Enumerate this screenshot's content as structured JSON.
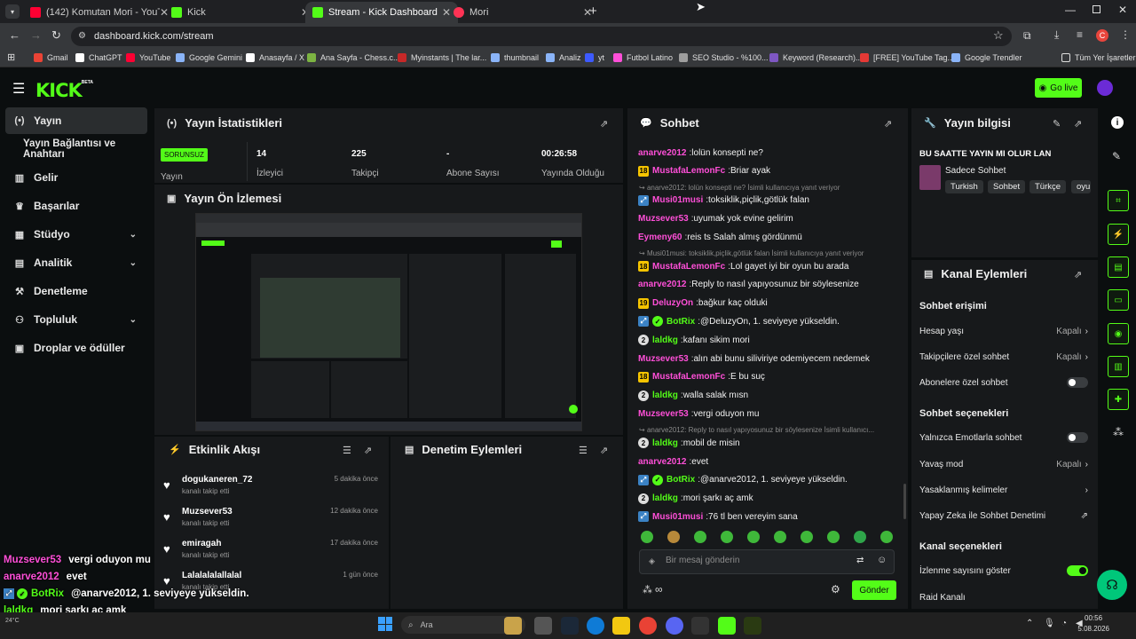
{
  "browser": {
    "tabs": [
      {
        "title": "(142) Komutan Mori - YouTube",
        "color": "#ff0033"
      },
      {
        "title": "Kick",
        "color": "#53fc18"
      },
      {
        "title": "Stream - Kick Dashboard",
        "color": "#53fc18"
      },
      {
        "title": "Mori",
        "color": "#ff3355"
      }
    ],
    "url": "dashboard.kick.com/stream",
    "profile_initial": "C",
    "bookmarks": [
      "Gmail",
      "ChatGPT",
      "YouTube",
      "Google Gemini",
      "Anasayfa / X",
      "Ana Sayfa - Chess.c...",
      "Myinstants | The lar...",
      "thumbnail",
      "Analiz",
      "yt",
      "Futbol Latino",
      "SEO Studio - %100...",
      "Keyword (Research)...",
      "[FREE] YouTube Tag...",
      "Google Trendler"
    ],
    "all_bookmarks": "Tüm Yer İşaretleri"
  },
  "header": {
    "logo": "KICK",
    "beta": "BETA",
    "go_live": "Go live"
  },
  "sidebar": {
    "items": [
      {
        "label": "Yayın",
        "icon": "broadcast-icon"
      },
      {
        "label": "Yayın Bağlantısı ve Anahtarı",
        "icon": ""
      },
      {
        "label": "Gelir",
        "icon": "chart-icon"
      },
      {
        "label": "Başarılar",
        "icon": "trophy-icon"
      },
      {
        "label": "Stüdyo",
        "icon": "studio-icon"
      },
      {
        "label": "Analitik",
        "icon": "analytics-icon"
      },
      {
        "label": "Denetleme",
        "icon": "hammer-icon"
      },
      {
        "label": "Topluluk",
        "icon": "community-icon"
      },
      {
        "label": "Droplar ve ödüller",
        "icon": "gift-icon"
      }
    ]
  },
  "stats": {
    "title": "Yayın İstatistikleri",
    "status_badge": "SORUNSUZ",
    "status_label": "Yayın",
    "viewers_value": "14",
    "viewers_label": "İzleyici",
    "followers_value": "225",
    "followers_label": "Takipçi",
    "subs_value": "-",
    "subs_label": "Abone Sayısı",
    "uptime_value": "00:26:58",
    "uptime_label": "Yayında Olduğu"
  },
  "preview": {
    "title": "Yayın Ön İzlemesi"
  },
  "activity": {
    "title": "Etkinlik Akışı",
    "items": [
      {
        "name": "dogukaneren_72",
        "sub": "kanalı takip etti",
        "time": "5 dakika önce"
      },
      {
        "name": "Muzsever53",
        "sub": "kanalı takip etti",
        "time": "12 dakika önce"
      },
      {
        "name": "emiragah",
        "sub": "kanalı takip etti",
        "time": "17 dakika önce"
      },
      {
        "name": "Lalalalalallalal",
        "sub": "kanalı takip etti",
        "time": "1 gün önce"
      }
    ]
  },
  "moderation": {
    "title": "Denetim Eylemleri"
  },
  "chat": {
    "title": "Sohbet",
    "placeholder": "Bir mesaj gönderin",
    "send": "Gönder",
    "lines": [
      {
        "user": "anarve2012",
        "color": "#ff4fd8",
        "msg": "lolün konsepti ne?",
        "badge": ""
      },
      {
        "user": "MustafaLemonFc",
        "color": "#ff4fd8",
        "msg": "Briar ayak",
        "badge": "18"
      },
      {
        "reply": "anarve2012: lolün konsepti ne? İsimli kullanıcıya yanıt veriyor"
      },
      {
        "user": "Musi01musi",
        "color": "#ff4fd8",
        "msg": "toksiklik,piçlik,götlük falan",
        "badge": "X"
      },
      {
        "user": "Muzsever53",
        "color": "#ff4fd8",
        "msg": "uyumak yok evine gelirim",
        "badge": ""
      },
      {
        "user": "Eymeny60",
        "color": "#ff4fd8",
        "msg": "reis ts Salah almış gördünmü",
        "badge": ""
      },
      {
        "reply": "Musi01musi: toksiklik,piçlik,götlük falan İsimli kullanıcıya yanıt veriyor"
      },
      {
        "user": "MustafaLemonFc",
        "color": "#ff4fd8",
        "msg": "Lol gayet iyi bir oyun bu arada",
        "badge": "18"
      },
      {
        "user": "anarve2012",
        "color": "#ff4fd8",
        "msg": "Reply to nasıl yapıyosunuz bir söylesenize",
        "badge": ""
      },
      {
        "user": "DeluzyOn",
        "color": "#ff4fd8",
        "msg": "bağkur kaç olduki",
        "badge": "19"
      },
      {
        "user": "BotRix",
        "color": "#53fc18",
        "msg": "@DeluzyOn, 1. seviyeye yükseldin.",
        "badge": "X"
      },
      {
        "user": "laldkg",
        "color": "#53fc18",
        "msg": "kafanı sikim mori",
        "badge": "2"
      },
      {
        "user": "Muzsever53",
        "color": "#ff4fd8",
        "msg": "alın abi bunu siliviriye odemiyecem nedemek",
        "badge": ""
      },
      {
        "user": "MustafaLemonFc",
        "color": "#ff4fd8",
        "msg": "E bu suç",
        "badge": "18"
      },
      {
        "user": "laldkg",
        "color": "#53fc18",
        "msg": "walla salak mısn",
        "badge": "2"
      },
      {
        "user": "Muzsever53",
        "color": "#ff4fd8",
        "msg": "vergi oduyon mu",
        "badge": ""
      },
      {
        "reply": "anarve2012: Reply to nasıl yapıyosunuz bir söylesenize İsimli kullanıcı..."
      },
      {
        "user": "laldkg",
        "color": "#53fc18",
        "msg": "mobil de misin",
        "badge": "2"
      },
      {
        "user": "anarve2012",
        "color": "#ff4fd8",
        "msg": "evet",
        "badge": ""
      },
      {
        "user": "BotRix",
        "color": "#53fc18",
        "msg": "@anarve2012, 1. seviyeye yükseldin.",
        "badge": "X"
      },
      {
        "user": "laldkg",
        "color": "#53fc18",
        "msg": "mori şarkı aç amk",
        "badge": "2"
      },
      {
        "user": "Musi01musi",
        "color": "#ff4fd8",
        "msg": "76 tl ben vereyim sana",
        "badge": "X"
      }
    ]
  },
  "stream_info": {
    "title": "Yayın bilgisi",
    "stream_title": "BU SAATTE YAYIN MI OLUR LAN",
    "category": "Sadece Sohbet",
    "tags": [
      "Turkish",
      "Sohbet",
      "Türkçe",
      "oyu"
    ]
  },
  "channel_actions": {
    "title": "Kanal Eylemleri",
    "chat_access": "Sohbet erişimi",
    "account_age": "Hesap yaşı",
    "follower_only": "Takipçilere özel sohbet",
    "subscriber_only": "Abonelere özel sohbet",
    "off": "Kapalı",
    "chat_options": "Sohbet seçenekleri",
    "emote_only": "Yalnızca Emotlarla sohbet",
    "slow_mode": "Yavaş mod",
    "banned_words": "Yasaklanmış kelimeler",
    "ai_moderation": "Yapay Zeka ile Sohbet Denetimi",
    "channel_options": "Kanal seçenekleri",
    "show_viewers": "İzlenme sayısını göster",
    "raid": "Raid Kanalı",
    "subscriber_only_on": false,
    "emote_only_on": false,
    "show_viewers_on": true
  },
  "overlay": {
    "lines": [
      {
        "user": "Muzsever53",
        "msg": "vergi oduyon mu",
        "color": "#ff4fd8"
      },
      {
        "user": "anarve2012",
        "msg": "evet",
        "color": "#ff4fd8"
      },
      {
        "user": "BotRix",
        "msg": "@anarve2012, 1. seviyeye yükseldin.",
        "color": "#53fc18"
      },
      {
        "user": "laldkg",
        "msg": "mori şarkı aç amk",
        "color": "#53fc18"
      },
      {
        "user": "Musi01musi",
        "msg": "76 tl ben vereyim sana",
        "color": "#ff4fd8"
      }
    ]
  },
  "taskbar": {
    "search": "Ara",
    "weather": "24°C",
    "time": "00:56",
    "date": "5.08.2026"
  },
  "colors": {
    "accent": "#53fc18",
    "pink": "#ff4fd8",
    "panel": "#17191b",
    "bg": "#0b0e0f"
  }
}
